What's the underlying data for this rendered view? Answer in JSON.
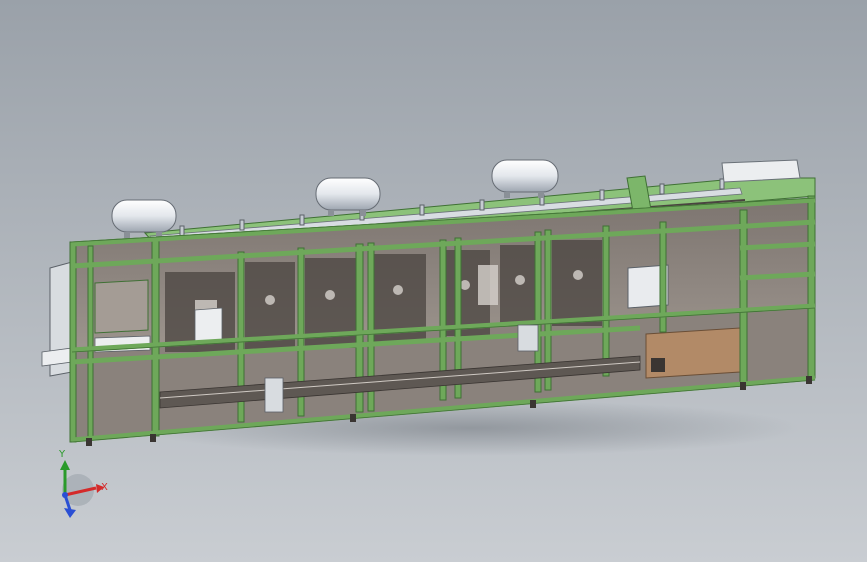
{
  "colors": {
    "background_top": "#9aa1a9",
    "background_bottom": "#c9cdd2",
    "frame_green": "#6ea85a",
    "frame_green_dark": "#3f7034",
    "tank_white": "#f1f3f5",
    "panel_glass": "#8c8580",
    "machine_dark": "#4a4440",
    "brown_panel": "#b28a67",
    "axis_x": "#d42a2a",
    "axis_y": "#2a9a2a",
    "axis_z": "#2a4fd4"
  },
  "triad": {
    "x_label": "X",
    "y_label": "Y"
  }
}
